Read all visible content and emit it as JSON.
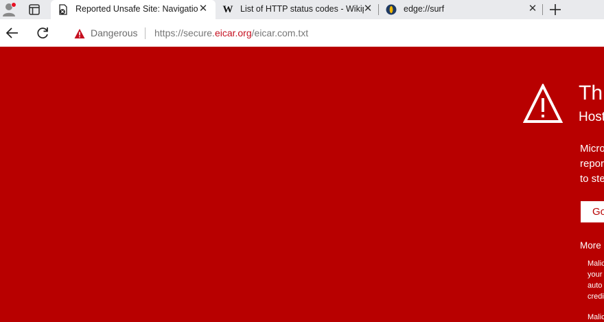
{
  "tabs": [
    {
      "title": "Reported Unsafe Site: Navigation",
      "close": "✕"
    },
    {
      "title": "List of HTTP status codes - Wikip",
      "close": "✕",
      "favicon": "W"
    },
    {
      "title": "edge://surf",
      "close": "✕"
    }
  ],
  "new_tab": "+",
  "omnibox": {
    "security_label": "Dangerous",
    "url_prefix": "https://secure.",
    "url_host": "eicar.org",
    "url_path": "/eicar.com.txt"
  },
  "page": {
    "headline": "Thi",
    "subline": "Host",
    "body_lines": [
      "Micro",
      "repor",
      "to ste"
    ],
    "go_button": "Go",
    "more_label": "More",
    "detail_1": [
      "Malic",
      "your",
      "auto",
      "credi"
    ],
    "detail_2": "Malic"
  },
  "colors": {
    "danger_red": "#b80000",
    "url_host_red": "#c50f1f"
  }
}
